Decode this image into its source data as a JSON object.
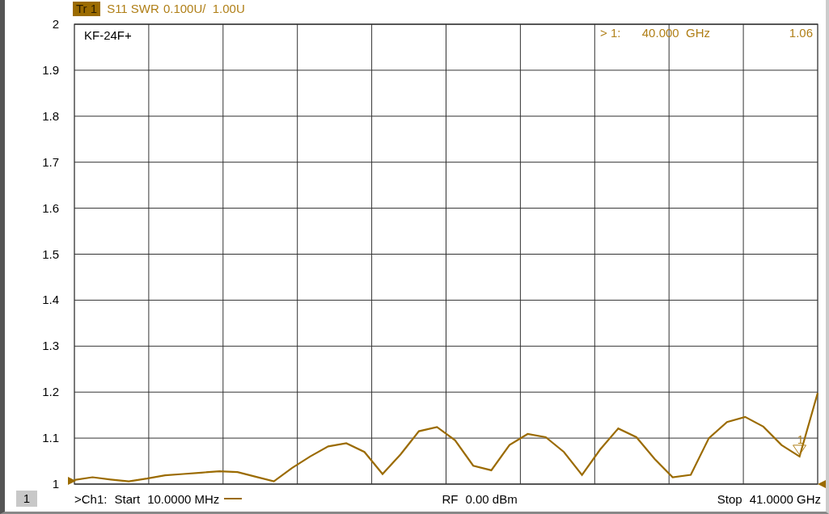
{
  "trace_header": {
    "badge": "Tr 1",
    "scale": "0.100U/  1.00U"
  },
  "chart_data": {
    "type": "line",
    "title": "KF-24F+",
    "ylim": [
      1,
      2
    ],
    "categories": [
      null,
      null,
      null,
      null,
      null,
      null,
      null,
      null,
      null,
      null,
      null,
      null,
      null,
      null,
      null,
      null,
      null,
      null,
      null,
      null,
      null,
      null,
      null,
      null,
      null,
      null,
      null,
      null,
      null,
      null,
      null,
      null,
      null,
      null,
      null,
      null,
      null,
      null,
      null,
      null,
      null,
      null
    ],
    "series": [
      {
        "name": "S11 SWR",
        "color": "#9b6b00",
        "values": [
          1.009,
          1.015,
          1.01,
          1.006,
          1.012,
          1.019,
          1.022,
          1.025,
          1.028,
          1.026,
          1.016,
          1.006,
          1.035,
          1.06,
          1.082,
          1.089,
          1.07,
          1.022,
          1.065,
          1.115,
          1.124,
          1.095,
          1.04,
          1.03,
          1.085,
          1.109,
          1.102,
          1.07,
          1.02,
          1.075,
          1.121,
          1.102,
          1.055,
          1.015,
          1.02,
          1.1,
          1.135,
          1.146,
          1.125,
          1.085,
          1.06,
          1.198
        ]
      }
    ],
    "yticks": [
      {
        "value": 2,
        "label": "2"
      },
      {
        "value": 1.9,
        "label": "1.9"
      },
      {
        "value": 1.8,
        "label": "1.8"
      },
      {
        "value": 1.7,
        "label": "1.7"
      },
      {
        "value": 1.6,
        "label": "1.6"
      },
      {
        "value": 1.5,
        "label": "1.5"
      },
      {
        "value": 1.4,
        "label": "1.4"
      },
      {
        "value": 1.3,
        "label": "1.3"
      },
      {
        "value": 1.2,
        "label": "1.2"
      },
      {
        "value": 1.1,
        "label": "1.1"
      },
      {
        "value": 1,
        "label": "1"
      }
    ],
    "grid": true,
    "annotations": [
      {
        "text": "1"
      }
    ]
  },
  "marker_readout": {
    "label": "> 1:",
    "frequency": "40.000  GHz",
    "value": "1.06"
  },
  "channel_button": "1",
  "footer": {
    "channel": ">Ch1:",
    "start_label": "Start",
    "start_value": "10.0000 MHz",
    "power_label": "RF",
    "power_value": "0.00 dBm",
    "stop_label": "Stop",
    "stop_value": "41.0000 GHz"
  }
}
